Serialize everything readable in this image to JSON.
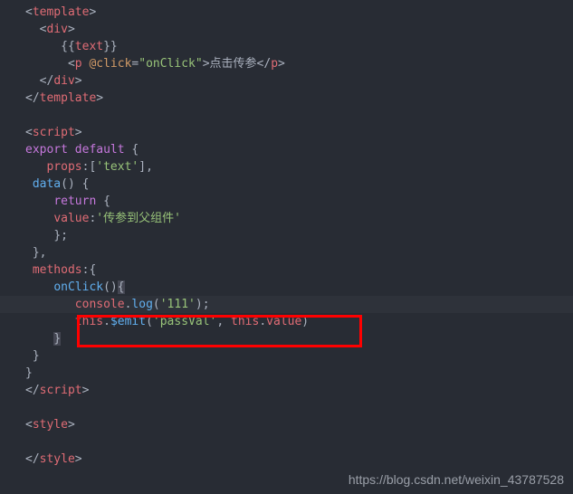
{
  "code": {
    "l1_tag": "template",
    "l2_tag": "div",
    "l3_open": "{{",
    "l3_var": "text",
    "l3_close": "}}",
    "l4_tag": "p",
    "l4_attr": "@click",
    "l4_val": "\"onClick\"",
    "l4_text": "点击传参",
    "l5_tag": "div",
    "l6_tag": "template",
    "l8_tag": "script",
    "l9_export": "export",
    "l9_default": "default",
    "l10_props": "props",
    "l10_val": "'text'",
    "l11_data": "data",
    "l12_return": "return",
    "l13_value": "value",
    "l13_str": "'传参到父组件'",
    "l16_methods": "methods",
    "l17_onclick": "onClick",
    "l18_console": "console",
    "l18_log": "log",
    "l18_arg": "'111'",
    "l19_this": "this",
    "l19_emit": "$emit",
    "l19_arg1": "'passVal'",
    "l19_this2": "this",
    "l19_value": "value",
    "l23_tag": "script",
    "l25_tag": "style",
    "l27_tag": "style"
  },
  "watermark": "https://blog.csdn.net/weixin_43787528"
}
